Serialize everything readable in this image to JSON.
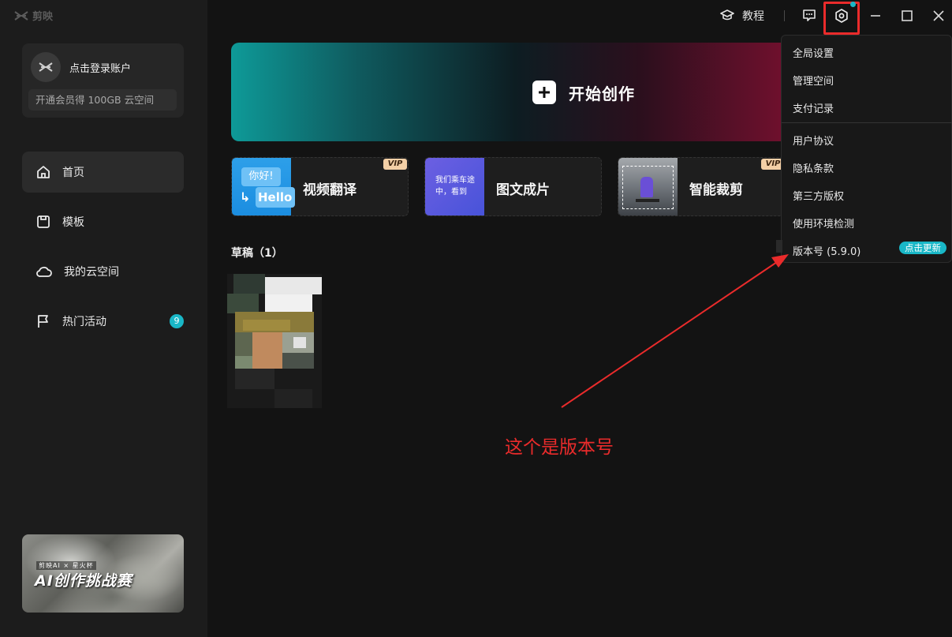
{
  "app": {
    "logo_text": "剪映"
  },
  "account": {
    "login_label": "点击登录账户",
    "vip_offer": "开通会员得 100GB 云空间"
  },
  "nav": {
    "items": [
      {
        "label": "首页",
        "icon": "home-icon",
        "active": true
      },
      {
        "label": "模板",
        "icon": "template-icon",
        "active": false
      },
      {
        "label": "我的云空间",
        "icon": "cloud-icon",
        "active": false
      },
      {
        "label": "热门活动",
        "icon": "flag-icon",
        "active": false,
        "badge": "9"
      }
    ]
  },
  "promo": {
    "small_text": "剪映AI × 星火杯",
    "title": "AI创作挑战赛"
  },
  "topbar": {
    "tutorial_label": "教程"
  },
  "hero": {
    "label": "开始创作"
  },
  "features": [
    {
      "label": "视频翻译",
      "vip": "VIP",
      "thumb_text_1": "你好!",
      "thumb_text_2": "Hello"
    },
    {
      "label": "图文成片",
      "thumb_text": "我们乘车途中，看到"
    },
    {
      "label": "智能裁剪",
      "vip": "VIP"
    }
  ],
  "drafts": {
    "title": "草稿（1）"
  },
  "menu": {
    "items": [
      "全局设置",
      "管理空间",
      "支付记录",
      "用户协议",
      "隐私条款",
      "第三方版权",
      "使用环境检测"
    ],
    "version_label": "版本号 (5.9.0)",
    "update_label": "点击更新"
  },
  "annotation": {
    "text": "这个是版本号",
    "color": "#ea2b2b"
  },
  "colors": {
    "accent": "#19b7c7",
    "background": "#131313",
    "sidebar": "#1c1c1c"
  }
}
